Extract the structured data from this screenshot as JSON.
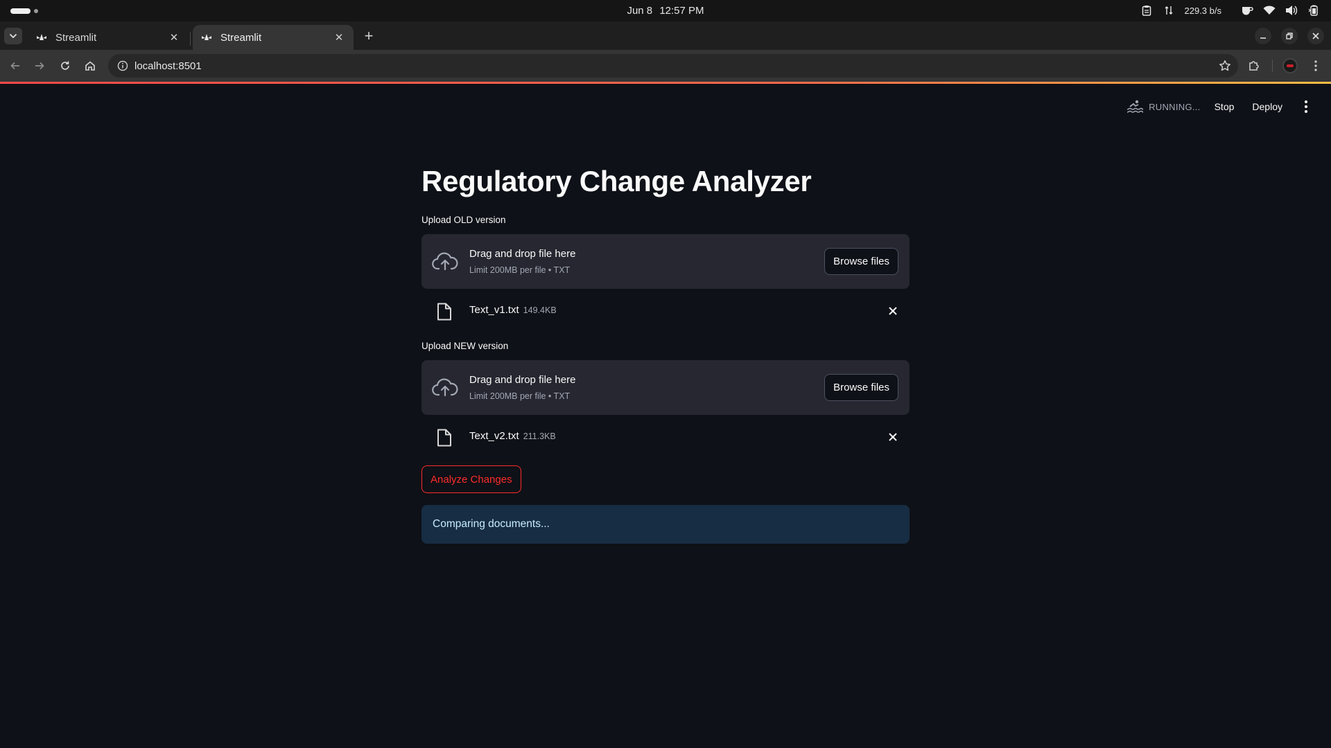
{
  "os": {
    "date": "Jun 8",
    "time": "12:57 PM",
    "net_speed": "229.3 b/s"
  },
  "browser": {
    "tabs": [
      {
        "title": "Streamlit",
        "active": false
      },
      {
        "title": "Streamlit",
        "active": true
      }
    ],
    "url": "localhost:8501"
  },
  "app": {
    "status": {
      "running_label": "RUNNING...",
      "stop_label": "Stop",
      "deploy_label": "Deploy"
    },
    "title": "Regulatory Change Analyzer",
    "uploaders": [
      {
        "label": "Upload OLD version",
        "drop_text": "Drag and drop file here",
        "limit_text": "Limit 200MB per file • TXT",
        "browse_label": "Browse files",
        "file": {
          "name": "Text_v1.txt",
          "size": "149.4KB"
        }
      },
      {
        "label": "Upload NEW version",
        "drop_text": "Drag and drop file here",
        "limit_text": "Limit 200MB per file • TXT",
        "browse_label": "Browse files",
        "file": {
          "name": "Text_v2.txt",
          "size": "211.3KB"
        }
      }
    ],
    "analyze_label": "Analyze Changes",
    "info_message": "Comparing documents...",
    "colors": {
      "background": "#0e1117",
      "secondary_bg": "#262730",
      "primary": "#ff2b2b",
      "info_bg": "#172d43",
      "info_text": "#c7ebff"
    }
  }
}
